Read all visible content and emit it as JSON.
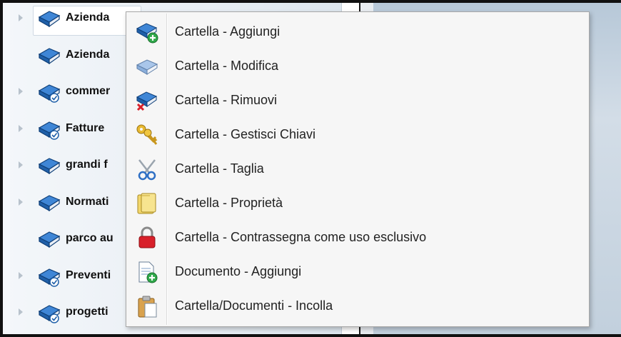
{
  "tree": {
    "items": [
      {
        "label": "Azienda",
        "icon": "book-icon",
        "expandable": true,
        "selected": true
      },
      {
        "label": "Azienda",
        "icon": "book-icon",
        "expandable": false
      },
      {
        "label": "commer",
        "icon": "shared-book-icon",
        "expandable": true
      },
      {
        "label": "Fatture",
        "icon": "shared-book-icon",
        "expandable": true
      },
      {
        "label": "grandi f",
        "icon": "book-icon",
        "expandable": true
      },
      {
        "label": "Normati",
        "icon": "book-icon",
        "expandable": true
      },
      {
        "label": "parco au",
        "icon": "book-icon",
        "expandable": false
      },
      {
        "label": "Preventi",
        "icon": "shared-book-icon",
        "expandable": true
      },
      {
        "label": "progetti",
        "icon": "shared-book-icon",
        "expandable": true
      }
    ]
  },
  "context_menu": {
    "items": [
      {
        "label": "Cartella - Aggiungi",
        "icon": "folder-add-icon"
      },
      {
        "label": "Cartella - Modifica",
        "icon": "folder-edit-icon"
      },
      {
        "label": "Cartella - Rimuovi",
        "icon": "folder-remove-icon"
      },
      {
        "label": "Cartella - Gestisci Chiavi",
        "icon": "keys-icon"
      },
      {
        "label": "Cartella - Taglia",
        "icon": "scissors-icon"
      },
      {
        "label": "Cartella - Proprietà",
        "icon": "folder-properties-icon"
      },
      {
        "label": "Cartella - Contrassegna come uso esclusivo",
        "icon": "lock-icon"
      },
      {
        "label": "Documento - Aggiungi",
        "icon": "document-add-icon"
      },
      {
        "label": "Cartella/Documenti - Incolla",
        "icon": "paste-icon"
      }
    ]
  },
  "colors": {
    "book_blue": "#1f5fa8",
    "lock_red": "#d8202a",
    "key_gold": "#d9a520"
  }
}
